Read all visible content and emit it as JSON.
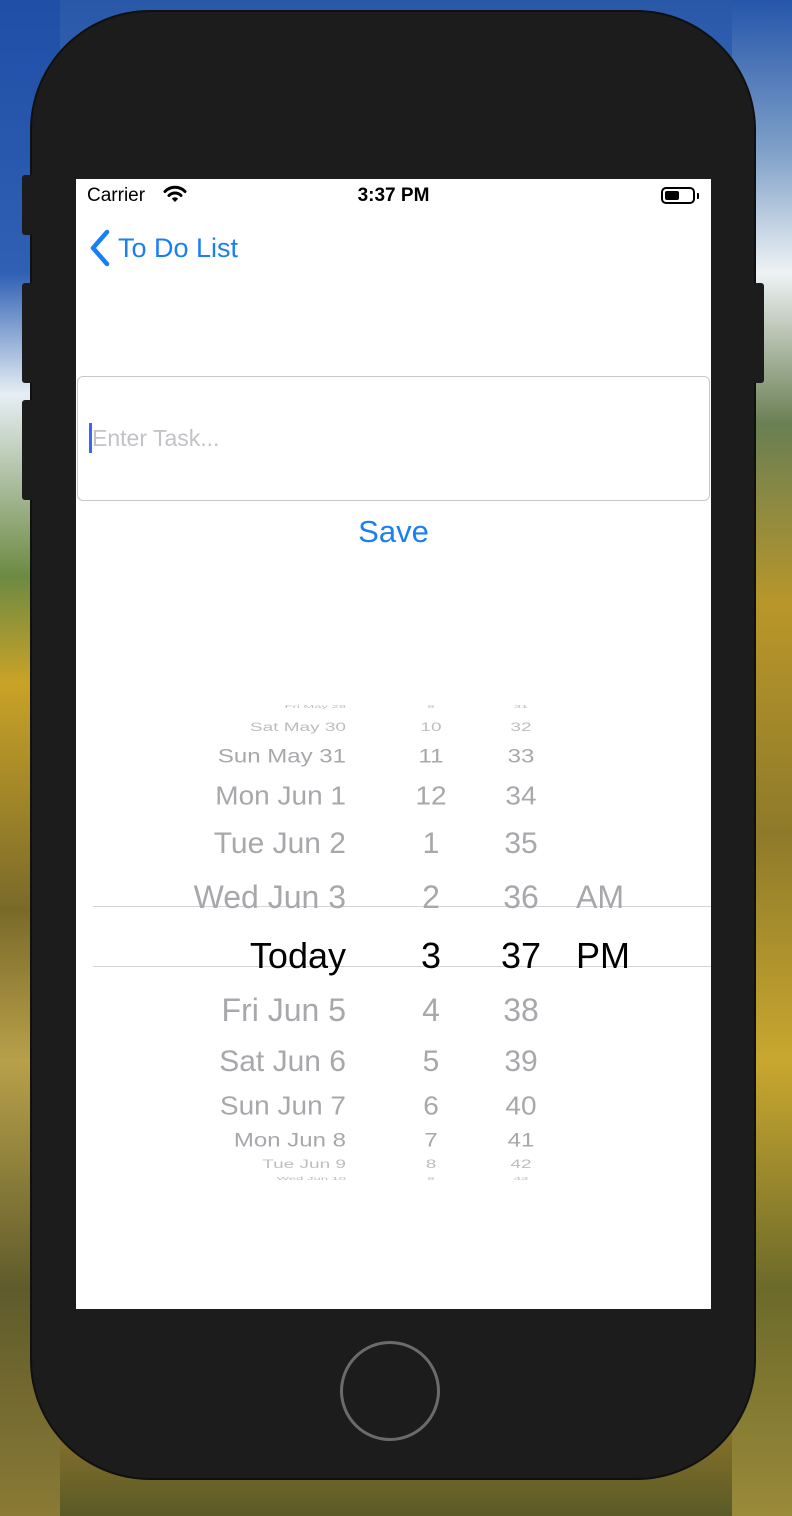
{
  "status_bar": {
    "carrier": "Carrier",
    "time": "3:37 PM"
  },
  "nav": {
    "back_label": "To Do List"
  },
  "task_input": {
    "placeholder": "Enter Task...",
    "value": ""
  },
  "save_label": "Save",
  "picker": {
    "selected": {
      "date": "Today",
      "hour": "3",
      "minute": "37",
      "period": "PM"
    },
    "dates": [
      "Fri May 29",
      "Sat May 30",
      "Sun May 31",
      "Mon Jun 1",
      "Tue Jun 2",
      "Wed Jun 3",
      "Today",
      "Fri Jun 5",
      "Sat Jun 6",
      "Sun Jun 7",
      "Mon Jun 8",
      "Tue Jun 9",
      "Wed Jun 10"
    ],
    "hours": [
      "9",
      "10",
      "11",
      "12",
      "1",
      "2",
      "3",
      "4",
      "5",
      "6",
      "7",
      "8",
      "9"
    ],
    "minutes": [
      "31",
      "32",
      "33",
      "34",
      "35",
      "36",
      "37",
      "38",
      "39",
      "40",
      "41",
      "42",
      "43"
    ],
    "periods": [
      "AM",
      "PM"
    ]
  },
  "colors": {
    "tint": "#1a7ef5",
    "selected_text": "#000000",
    "dim_text": "#a8a8ac"
  }
}
